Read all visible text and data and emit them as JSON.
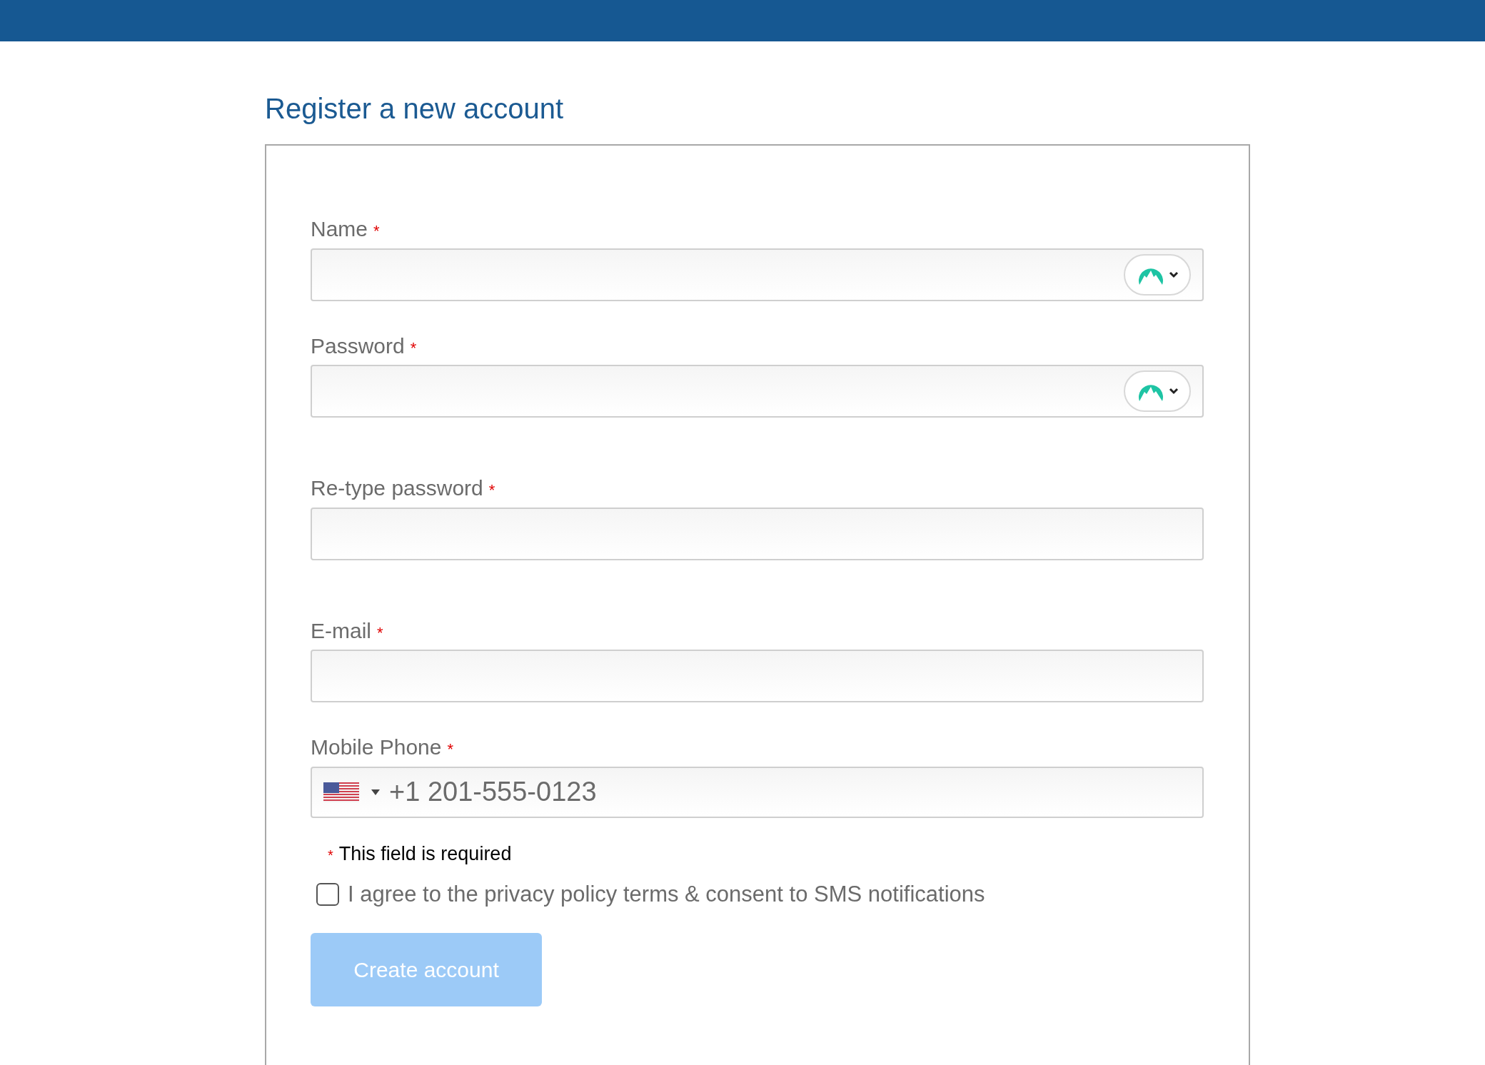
{
  "title": "Register a new account",
  "fields": [
    {
      "kind": "text",
      "label": "Name",
      "required_mark": "*",
      "password_manager": true
    },
    {
      "kind": "password",
      "label": "Password",
      "required_mark": "*",
      "password_manager": true
    },
    {
      "kind": "password",
      "label": "Re-type password",
      "required_mark": "*",
      "password_manager": false
    },
    {
      "kind": "email",
      "label": "E-mail",
      "required_mark": "*",
      "password_manager": false
    },
    {
      "kind": "phone",
      "label": "Mobile Phone",
      "required_mark": "*",
      "placeholder": "+1 201-555-0123"
    }
  ],
  "required_note": {
    "mark": "*",
    "text": "This field is required"
  },
  "agree": {
    "label": "I agree to the privacy policy terms & consent to SMS notifications",
    "checked": false
  },
  "submit": {
    "label": "Create account",
    "disabled": true
  }
}
